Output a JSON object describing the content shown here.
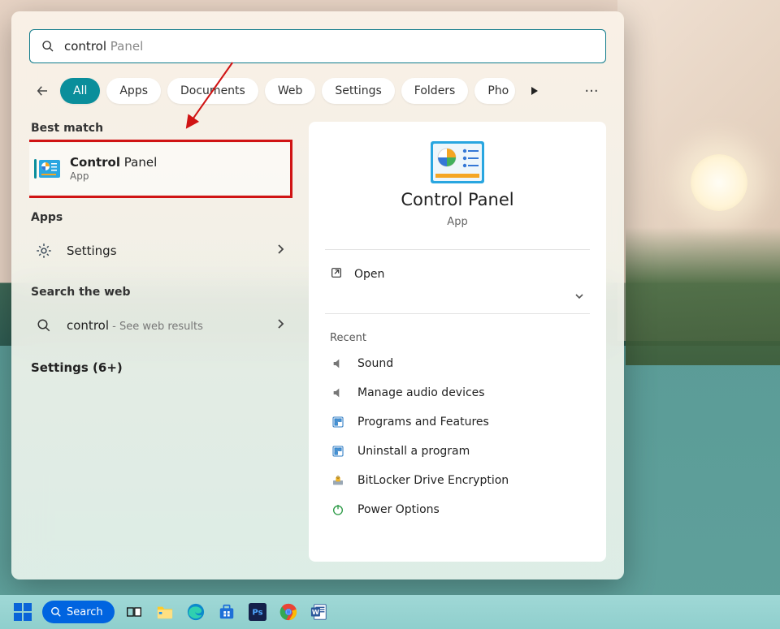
{
  "search": {
    "query_typed": "control",
    "query_ghost": " Panel"
  },
  "filters": {
    "all": "All",
    "apps": "Apps",
    "documents": "Documents",
    "web": "Web",
    "settings": "Settings",
    "folders": "Folders",
    "photos": "Pho"
  },
  "left": {
    "best_match_header": "Best match",
    "best_match": {
      "title_bold": "Control",
      "title_light": " Panel",
      "sub": "App"
    },
    "apps_header": "Apps",
    "settings_row": {
      "label": "Settings"
    },
    "web_header": "Search the web",
    "web_row": {
      "term": "control",
      "suffix": " - See web results"
    },
    "settings_more": "Settings (6+)"
  },
  "preview": {
    "title": "Control Panel",
    "sub": "App",
    "open_label": "Open",
    "recent_header": "Recent",
    "recent": [
      {
        "label": "Sound"
      },
      {
        "label": "Manage audio devices"
      },
      {
        "label": "Programs and Features"
      },
      {
        "label": "Uninstall a program"
      },
      {
        "label": "BitLocker Drive Encryption"
      },
      {
        "label": "Power Options"
      }
    ]
  },
  "taskbar": {
    "search_label": "Search"
  }
}
